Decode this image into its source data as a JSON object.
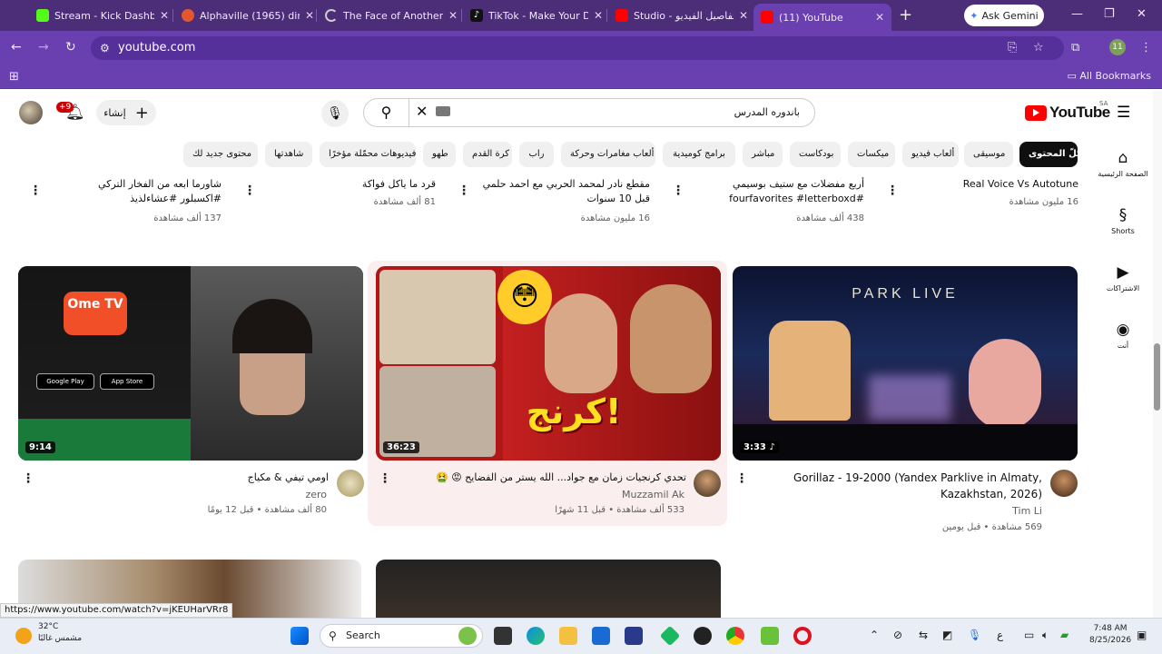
{
  "browser": {
    "tabs": [
      {
        "title": "Stream - Kick Dashboa",
        "fav": "#53fc18"
      },
      {
        "title": "Alphaville (1965) direc",
        "fav": "#e4572e"
      },
      {
        "title": "The Face of Another (1",
        "fav": "#cccccc"
      },
      {
        "title": "TikTok - Make Your Da",
        "fav": "#111111"
      },
      {
        "title": "Studio - تفاصيل الفيديو",
        "fav": "#ff0000"
      },
      {
        "title": "(11) YouTube",
        "fav": "#ff0000"
      }
    ],
    "ask_gemini": "Ask Gemini",
    "url": "youtube.com",
    "all_bookmarks": "All Bookmarks",
    "profile_badge": "11"
  },
  "header": {
    "create_label": "إنشاء",
    "notif_badge": "+9",
    "search_value": "باندوره المدرس",
    "logo_word": "YouTube",
    "country": "SA"
  },
  "chips": [
    "كلّ المحتوى",
    "موسيقى",
    "ألعاب فيديو",
    "ميكسات",
    "بودكاست",
    "مباشر",
    "برامج كوميدية",
    "ألعاب مغامرات وحركة",
    "راب",
    "كرة القدم",
    "طهو",
    "فيديوهات محمّلة مؤخرًا",
    "شاهدتها",
    "محتوى جديد لك"
  ],
  "sidebar": [
    {
      "label": "الصفحة الرئيسية"
    },
    {
      "label": "Shorts"
    },
    {
      "label": "الاشتراكات"
    },
    {
      "label": "أنت"
    }
  ],
  "row1": [
    {
      "title": "Real Voice Vs Autotune",
      "meta": "16 مليون مشاهدة"
    },
    {
      "title": "أربع مفضلات مع ستيف بوسيمي #fourfavorites #letterboxd",
      "meta": "438 ألف مشاهدة"
    },
    {
      "title": "مقطع نادر لمحمد الحربي مع احمد حلمي قبل 10 سنوات",
      "meta": "16 مليون مشاهدة"
    },
    {
      "title": "قرد ما ياكل فواكة",
      "meta": "81 ألف مشاهدة"
    },
    {
      "title": "شاورما ابعه من الفخار التركي #اكسبلور #عشاءلذيذ",
      "meta": "137 ألف مشاهدة"
    }
  ],
  "row2": [
    {
      "title": "Gorillaz - 19-2000 (Yandex Parklive in Almaty, Kazakhstan, 2026)",
      "channel": "Tim Li",
      "meta": "569 مشاهدة • قبل يومين",
      "duration": "3:33",
      "thumb_text": "PARK LIVE"
    },
    {
      "title": "تحدي كرنجيات زمان مع جواد... الله يستر من الفضايح 😡 🤮",
      "channel": "Muzzamil Ak",
      "meta": "533 ألف مشاهدة • قبل 11 شهرًا",
      "duration": "36:23",
      "thumb_text": "كرنج!"
    },
    {
      "title": "اومي تيفي & مكياج",
      "channel": "zero",
      "meta": "80 ألف مشاهدة • قبل 12 يومًا",
      "duration": "9:14",
      "thumb_text": "Ome TV"
    }
  ],
  "status_url": "https://www.youtube.com/watch?v=jKEUHarVRr8",
  "taskbar": {
    "temp": "32°C",
    "weather": "مشمس غالبًا",
    "search": "Search",
    "time": "7:48 AM",
    "date": "8/25/2026"
  }
}
